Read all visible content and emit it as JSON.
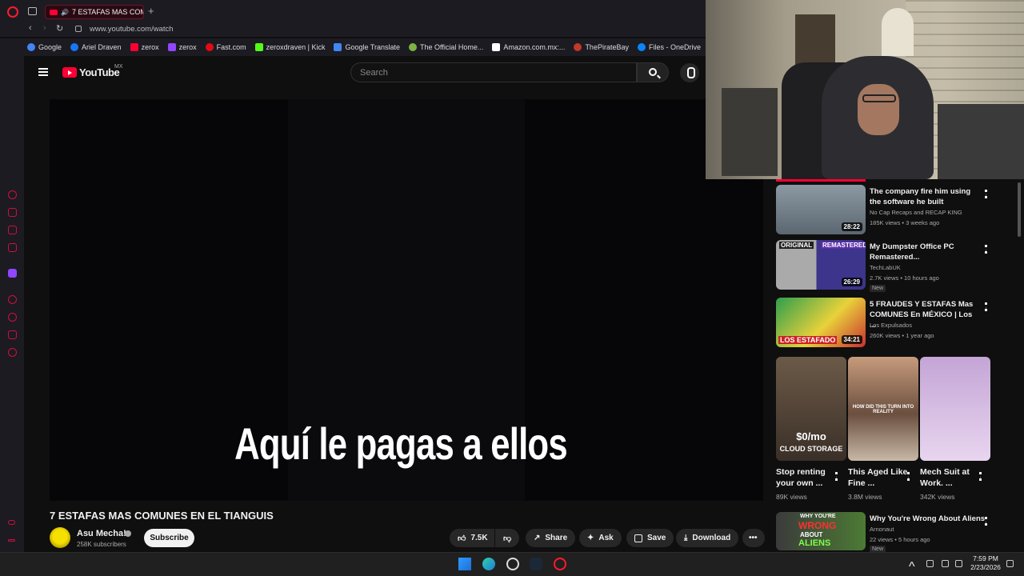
{
  "browser": {
    "tab_title": "7 ESTAFAS MAS COM...",
    "url": "www.youtube.com/watch",
    "new_tab_symbol": "+",
    "accent_color": "#ff1b2d",
    "bookmarks": [
      {
        "label": "Google",
        "color": "#4285f4"
      },
      {
        "label": "Ariel Draven",
        "color": "#1877f2"
      },
      {
        "label": "zerox",
        "color": "#ff0033"
      },
      {
        "label": "zerox",
        "color": "#9146ff"
      },
      {
        "label": "Fast.com",
        "color": "#e50914"
      },
      {
        "label": "zeroxdraven | Kick",
        "color": "#53fc18"
      },
      {
        "label": "Google Translate",
        "color": "#4285f4"
      },
      {
        "label": "The Official Home...",
        "color": "#7cb342"
      },
      {
        "label": "Amazon.com.mx:...",
        "color": "#ffffff"
      },
      {
        "label": "ThePirateBay",
        "color": "#c0392b"
      },
      {
        "label": "Files - OneDrive",
        "color": "#0a84ff"
      }
    ]
  },
  "youtube": {
    "logo_text": "YouTube",
    "region": "MX",
    "search_placeholder": "Search",
    "video": {
      "subtitle": "Aquí le pagas a ellos",
      "title": "7 ESTAFAS MAS COMUNES EN EL TIANGUIS",
      "channel": "Asu Mecha!",
      "subscribers": "258K subscribers",
      "subscribe_label": "Subscribe",
      "likes": "7.5K",
      "share_label": "Share",
      "ask_label": "Ask",
      "save_label": "Save",
      "download_label": "Download"
    },
    "recommendations": [
      {
        "title": "The company fire him using the software he built",
        "channel": "No Cap Recaps and RECAP KING",
        "meta": "185K views • 3 weeks ago",
        "duration": "28:22",
        "thumb_color": "#6d7b86"
      },
      {
        "title": "My Dumpster Office PC Remastered...",
        "channel": "TechLabUK",
        "meta": "2.7K views • 10 hours ago",
        "duration": "26:29",
        "badge": "New",
        "thumb_color": "#4a3f8f",
        "thumb_labels": [
          "ORIGINAL",
          "REMASTERED"
        ]
      },
      {
        "title": "5 FRAUDES Y ESTAFAS Mas COMUNES En MÉXICO | Los ...",
        "channel": "Los Expulsados",
        "meta": "260K views • 1 year ago",
        "duration": "34:21",
        "thumb_color": "#1b8f3a",
        "thumb_labels": [
          "LOS ESTAFADO"
        ]
      },
      {
        "title": "Why You're Wrong About Aliens",
        "channel": "Arnonaut",
        "meta": "22 views • 5 hours ago",
        "badge": "New",
        "thumb_color": "#2f4a2a",
        "thumb_labels": [
          "WHY YOU'RE",
          "WRONG",
          "ABOUT",
          "ALIENS"
        ]
      }
    ],
    "shorts": [
      {
        "title": "Stop renting your own ...",
        "views": "89K views",
        "thumb_color": "#5a4a3c",
        "thumb_text": "$0/mo",
        "thumb_sub": "CLOUD STORAGE"
      },
      {
        "title": "This Aged Like Fine ...",
        "views": "3.8M views",
        "thumb_color": "#7a6150",
        "thumb_text": "HOW DID THIS TURN INTO REALITY"
      },
      {
        "title": "Mech Suit at Work. ...",
        "views": "342K views",
        "thumb_color": "#c8a9d8"
      }
    ]
  },
  "taskbar": {
    "time": "7:59 PM",
    "date": "2/23/2026"
  }
}
